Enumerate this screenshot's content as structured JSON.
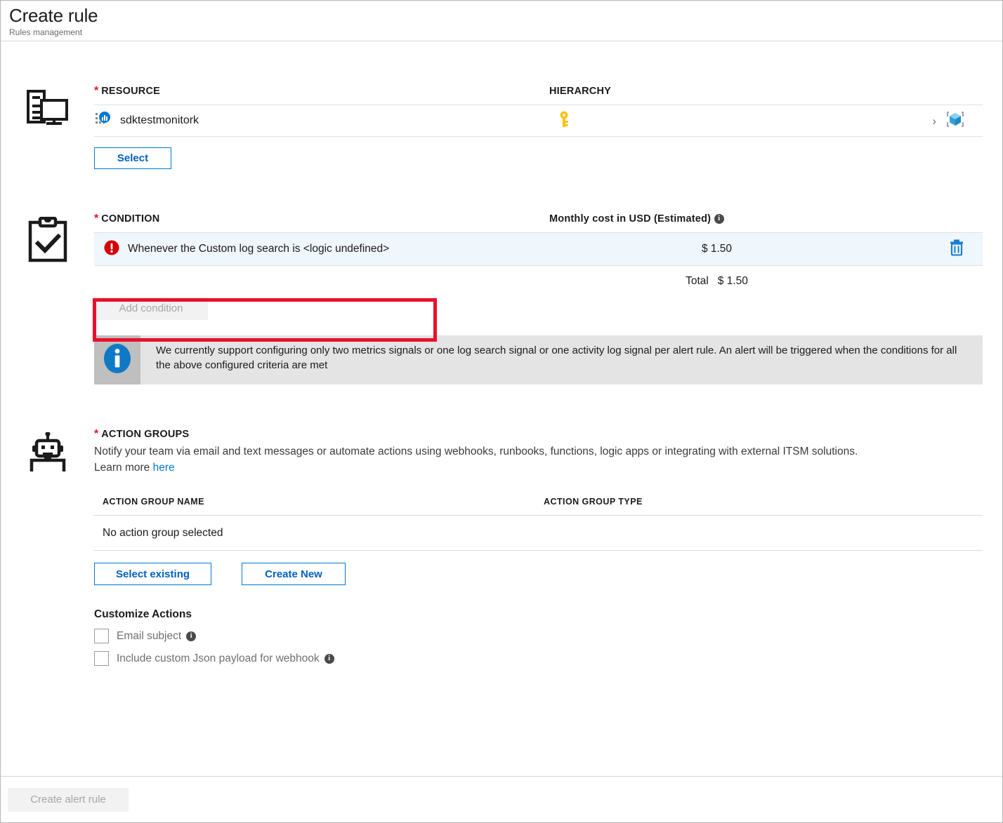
{
  "header": {
    "title": "Create rule",
    "subtitle": "Rules management"
  },
  "resource": {
    "icon": "computer-monitor-icon",
    "label": "RESOURCE",
    "hierarchy_label": "HIERARCHY",
    "name": "sdktestmonitork",
    "resource_icon": "app-insights-icon",
    "subscription_icon": "key-icon",
    "separator": "›",
    "resourcegroup_icon": "resource-group-cube-icon",
    "select_button": "Select"
  },
  "condition": {
    "icon": "clipboard-check-icon",
    "label": "CONDITION",
    "cost_header": "Monthly cost in USD (Estimated)",
    "cost_info_icon": "info-icon",
    "row": {
      "error_icon": "error-exclamation-icon",
      "text": "Whenever the Custom log search is <logic undefined>",
      "cost": "$ 1.50",
      "delete_icon": "trash-icon"
    },
    "total_label": "Total",
    "total_value": "$ 1.50",
    "add_condition_button": "Add condition",
    "info_banner": {
      "icon": "info-circle-icon",
      "text": "We currently support configuring only two metrics signals or one log search signal or one activity log signal per alert rule. An alert will be triggered when the conditions for all the above configured criteria are met"
    },
    "annotation_color": "#e8112d"
  },
  "action_groups": {
    "icon": "robot-icon",
    "label": "ACTION GROUPS",
    "description": "Notify your team via email and text messages or automate actions using webhooks, runbooks, functions, logic apps or integrating with external ITSM solutions.",
    "learn_more_prefix": "Learn more",
    "learn_more_link": "here",
    "table": {
      "columns": [
        "ACTION GROUP NAME",
        "ACTION GROUP TYPE"
      ],
      "empty_text": "No action group selected"
    },
    "select_existing_button": "Select existing",
    "create_new_button": "Create New",
    "customize_title": "Customize Actions",
    "checkboxes": [
      {
        "label": "Email subject",
        "checked": false,
        "info_icon": "info-icon"
      },
      {
        "label": "Include custom Json payload for webhook",
        "checked": false,
        "info_icon": "info-icon"
      }
    ]
  },
  "footer": {
    "create_alert_rule_button": "Create alert rule"
  },
  "colors": {
    "accent": "#0078d4",
    "error": "#e81123",
    "annotation": "#e8112d",
    "row_highlight": "#eff6fc"
  }
}
